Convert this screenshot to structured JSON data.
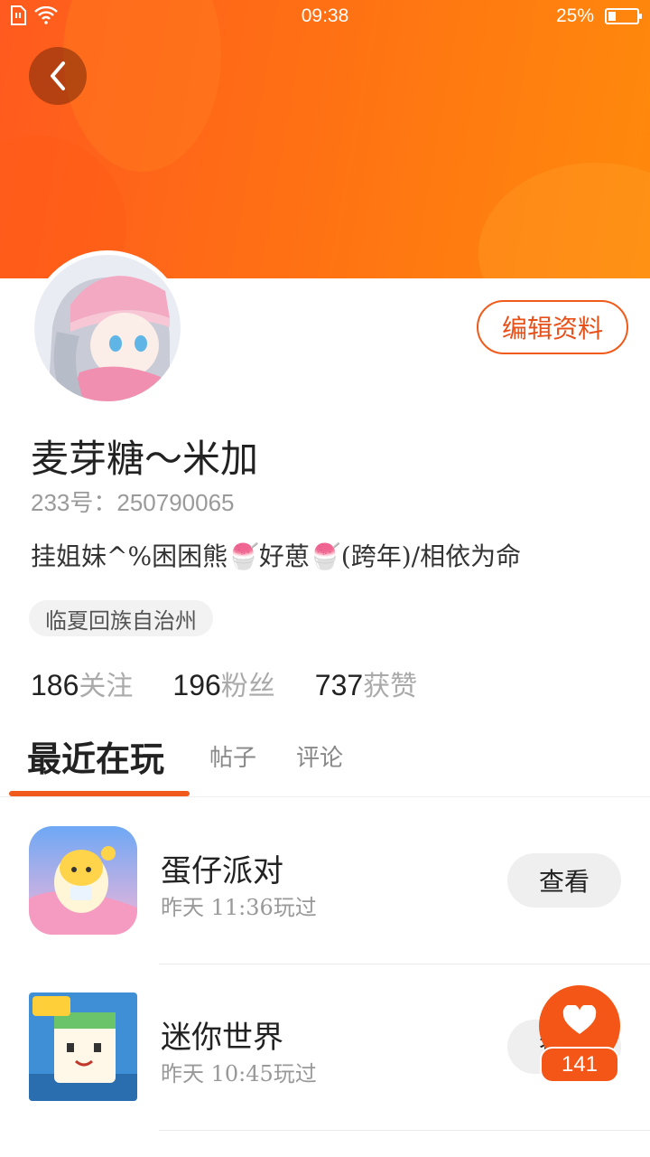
{
  "status_bar": {
    "time": "09:38",
    "battery": "25%",
    "battery_level": 0.25
  },
  "profile": {
    "nickname": "麦芽糖～米加",
    "uid": "233号：250790065",
    "bio": "挂姐妹^%困困熊🍧好葸🍧(跨年)/相依为命",
    "location": "临夏回族自治州",
    "edit_label": "编辑资料"
  },
  "stats": [
    {
      "num": "186",
      "label": "关注"
    },
    {
      "num": "196",
      "label": "粉丝"
    },
    {
      "num": "737",
      "label": "获赞"
    }
  ],
  "tabs": [
    "最近在玩",
    "帖子",
    "评论"
  ],
  "games": [
    {
      "name": "蛋仔派对",
      "time": "昨天  11:36玩过",
      "button": "查看"
    },
    {
      "name": "迷你世界",
      "time": "昨天  10:45玩过",
      "button": "查看"
    }
  ],
  "like": {
    "count": "141"
  },
  "colors": {
    "accent": "#f05a1a",
    "banner": "#ff6f14"
  }
}
